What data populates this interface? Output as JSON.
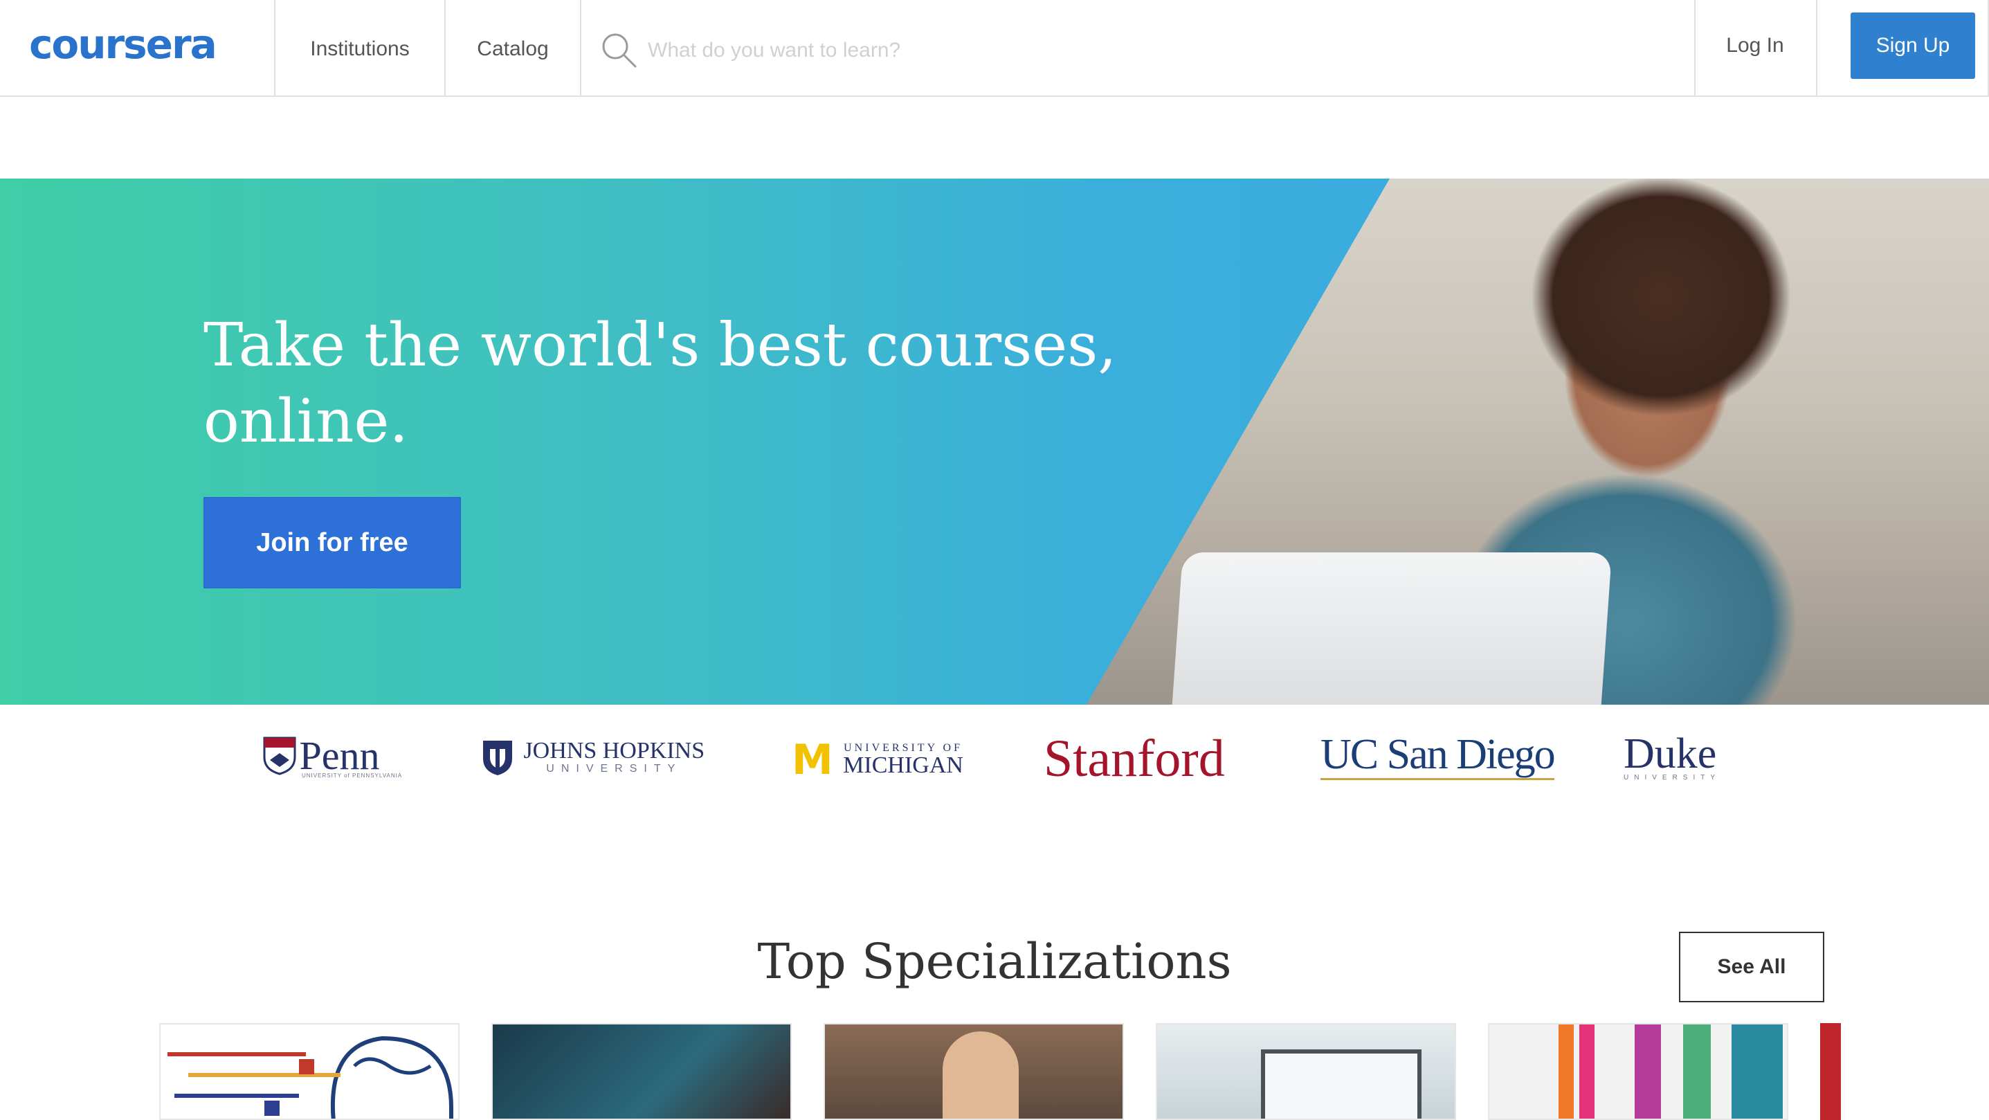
{
  "header": {
    "logo_text": "coursera",
    "nav": [
      {
        "label": "Institutions"
      },
      {
        "label": "Catalog"
      }
    ],
    "search": {
      "placeholder": "What do you want to learn?",
      "value": ""
    },
    "login_label": "Log In",
    "signup_label": "Sign Up"
  },
  "hero": {
    "title_line1": "Take the world's best courses,",
    "title_line2": "online.",
    "cta_label": "Join for free"
  },
  "partners": [
    {
      "name": "Penn",
      "sub": "UNIVERSITY of PENNSYLVANIA"
    },
    {
      "name": "JOHNS HOPKINS",
      "sub": "UNIVERSITY"
    },
    {
      "name": "MICHIGAN",
      "prefix": "UNIVERSITY OF"
    },
    {
      "name": "Stanford"
    },
    {
      "name": "UC San Diego"
    },
    {
      "name": "Duke",
      "sub": "UNIVERSITY"
    }
  ],
  "specializations": {
    "title": "Top Specializations",
    "see_all_label": "See All"
  },
  "colors": {
    "brand": "#2a73cc",
    "signup_bg": "#2f80cf",
    "cta_bg": "#2d70d8",
    "stanford": "#a4152b",
    "michigan_gold": "#f2c200",
    "navy": "#25336a"
  }
}
